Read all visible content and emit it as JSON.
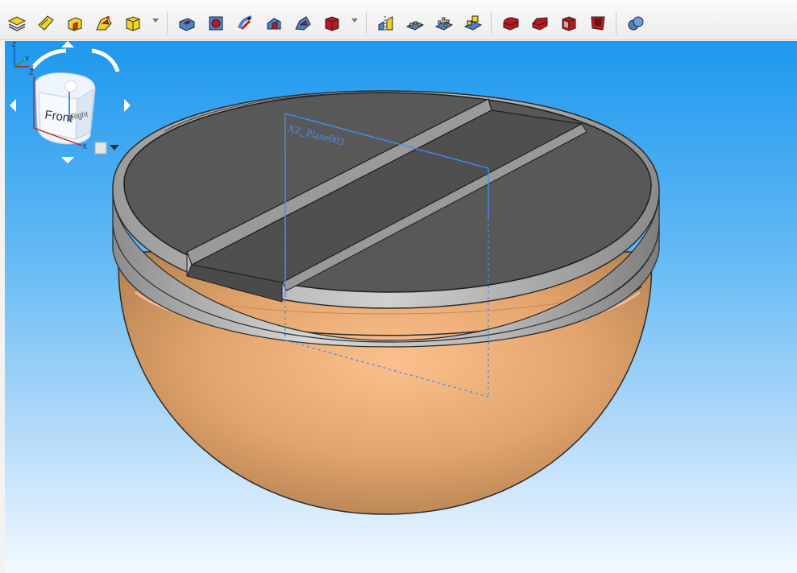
{
  "toolbar": {
    "group1": [
      {
        "name": "sketch-layer-tool",
        "icon": "layers-icon"
      },
      {
        "name": "sketch-profile-tool",
        "icon": "profile-icon"
      },
      {
        "name": "pad-feature-tool",
        "icon": "pad-icon"
      },
      {
        "name": "revolve-feature-tool",
        "icon": "revolve-icon"
      },
      {
        "name": "additive-primitive-tool",
        "icon": "cube-primitive-icon"
      }
    ],
    "group2": [
      {
        "name": "pocket-feature-tool",
        "icon": "pocket-icon"
      },
      {
        "name": "hole-feature-tool",
        "icon": "hole-icon"
      },
      {
        "name": "groove-feature-tool",
        "icon": "groove-icon"
      },
      {
        "name": "subtractive-loft-tool",
        "icon": "subtractive-loft-icon"
      },
      {
        "name": "subtractive-pipe-tool",
        "icon": "subtractive-pipe-icon"
      },
      {
        "name": "subtractive-primitive-tool",
        "icon": "subtractive-cube-icon"
      }
    ],
    "group3": [
      {
        "name": "mirrored-feature-tool",
        "icon": "mirror-icon"
      },
      {
        "name": "linear-pattern-tool",
        "icon": "linear-pattern-icon"
      },
      {
        "name": "polar-pattern-tool",
        "icon": "polar-pattern-icon"
      },
      {
        "name": "multi-transform-tool",
        "icon": "multi-transform-icon"
      }
    ],
    "group4": [
      {
        "name": "fillet-tool",
        "icon": "fillet-icon"
      },
      {
        "name": "chamfer-tool",
        "icon": "chamfer-icon"
      },
      {
        "name": "draft-tool",
        "icon": "draft-icon"
      },
      {
        "name": "thickness-tool",
        "icon": "thickness-icon"
      }
    ],
    "group5": [
      {
        "name": "boolean-tool",
        "icon": "boolean-icon"
      }
    ]
  },
  "viewport": {
    "plane_label": "XZ_Plane003",
    "colors": {
      "bowl": "#e6a46c",
      "rim": "#bcbcbc",
      "lid": "#585858",
      "plane_outline": "#3c90ff"
    }
  },
  "navcube": {
    "front_label": "Front",
    "right_label": "Right",
    "axis_z": "Z",
    "axis_x": "X"
  },
  "axis_triad": {
    "z": "Z",
    "y": "Y",
    "x": "X"
  }
}
